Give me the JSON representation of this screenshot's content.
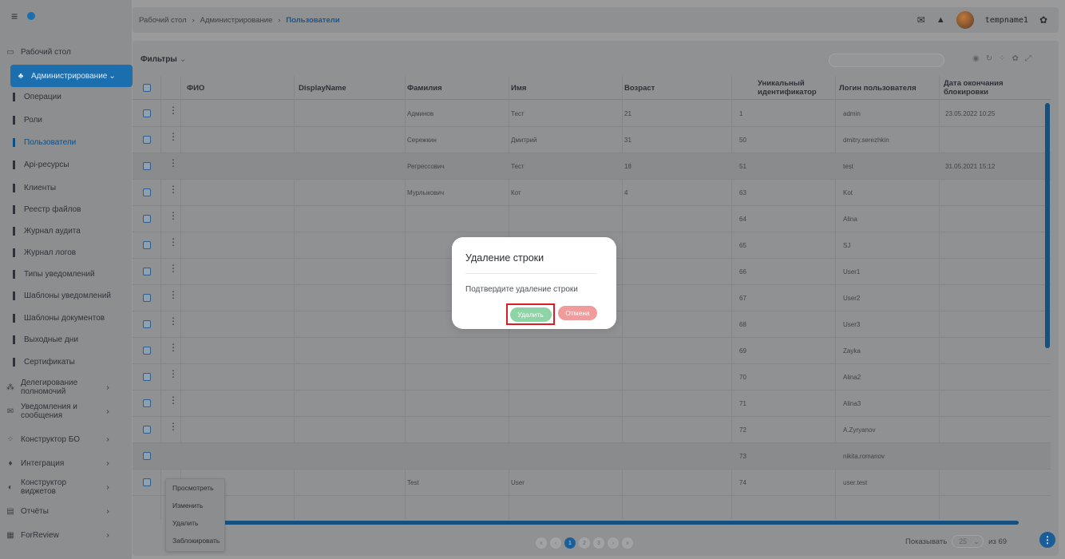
{
  "breadcrumb": [
    "Рабочий стол",
    "Администрирование",
    "Пользователи"
  ],
  "header": {
    "username": "tempname1"
  },
  "sidebar": {
    "top_items": [
      {
        "label": "Рабочий стол"
      }
    ],
    "active_section": {
      "label": "Администрирование"
    },
    "sub_items": [
      {
        "label": "Операции"
      },
      {
        "label": "Роли"
      },
      {
        "label": "Пользователи"
      },
      {
        "label": "Api-ресурсы"
      },
      {
        "label": "Клиенты"
      },
      {
        "label": "Реестр файлов"
      },
      {
        "label": "Журнал аудита"
      },
      {
        "label": "Журнал логов"
      },
      {
        "label": "Типы уведомлений"
      },
      {
        "label": "Шаблоны уведомлений"
      },
      {
        "label": "Шаблоны документов"
      },
      {
        "label": "Выходные дни"
      },
      {
        "label": "Сертификаты"
      }
    ],
    "sections": [
      {
        "label": "Делегирование полномочий"
      },
      {
        "label": "Уведомления и сообщения"
      },
      {
        "label": "Конструктор БО"
      },
      {
        "label": "Интеграция"
      },
      {
        "label": "Конструктор виджетов"
      },
      {
        "label": "Отчёты"
      },
      {
        "label": "ForReview"
      }
    ]
  },
  "main": {
    "filters_label": "Фильтры",
    "columns": [
      "ФИО",
      "DisplayName",
      "Фамилия",
      "Имя",
      "Возраст",
      "Уникальный идентификатор",
      "Логин пользователя",
      "Дата окончания блокировки"
    ],
    "rows": [
      [
        "",
        "",
        "Админов",
        "Тест",
        "21",
        "1",
        "admin",
        "23.05.2022 10:25"
      ],
      [
        "",
        "",
        "Сережкин",
        "Дмитрий",
        "31",
        "50",
        "dmitry.serezhkin",
        ""
      ],
      [
        "",
        "",
        "Регрессович",
        "Тест",
        "18",
        "51",
        "test",
        "31.05.2021 15:12"
      ],
      [
        "",
        "",
        "Мурлыкович",
        "Кот",
        "4",
        "63",
        "Kot",
        ""
      ],
      [
        "",
        "",
        "",
        "",
        "",
        "64",
        "Alina",
        ""
      ],
      [
        "",
        "",
        "",
        "",
        "",
        "65",
        "SJ",
        ""
      ],
      [
        "",
        "",
        "",
        "",
        "",
        "66",
        "User1",
        ""
      ],
      [
        "",
        "",
        "",
        "",
        "",
        "67",
        "User2",
        ""
      ],
      [
        "",
        "",
        "",
        "",
        "",
        "68",
        "User3",
        ""
      ],
      [
        "",
        "",
        "",
        "",
        "",
        "69",
        "Zayka",
        ""
      ],
      [
        "",
        "",
        "",
        "",
        "",
        "70",
        "Alina2",
        ""
      ],
      [
        "",
        "",
        "",
        "",
        "",
        "71",
        "Alina3",
        ""
      ],
      [
        "",
        "",
        "",
        "",
        "",
        "72",
        "A.Zyryanov",
        ""
      ],
      [
        "",
        "",
        "",
        "",
        "",
        "73",
        "nikita.romanov",
        ""
      ],
      [
        "",
        "",
        "Test",
        "User",
        "",
        "74",
        "user.test",
        ""
      ]
    ],
    "context_menu": [
      "Просмотреть",
      "Изменить",
      "Удалить",
      "Заблокировать"
    ],
    "pagination": {
      "pages": [
        "1",
        "2",
        "3"
      ],
      "show_label": "Показывать",
      "page_size": "25",
      "total": "из 69"
    }
  },
  "modal": {
    "title": "Удаление строки",
    "message": "Подтвердите удаление строки",
    "confirm_label": "Удалить",
    "cancel_label": "Отмена"
  },
  "colors": {
    "accent": "#1c6fae",
    "confirm": "#8fd4a6",
    "cancel": "#f19c9c",
    "highlight": "#d81e24"
  }
}
